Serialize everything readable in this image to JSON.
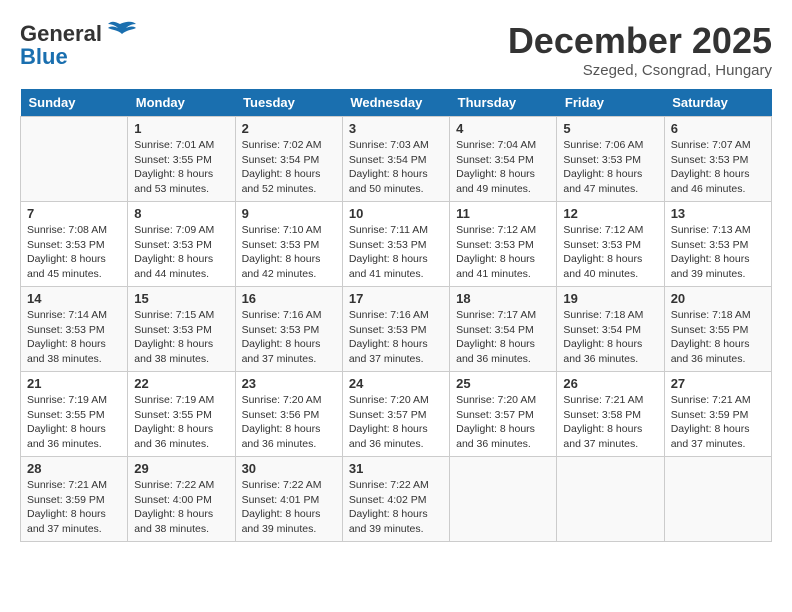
{
  "header": {
    "logo_general": "General",
    "logo_blue": "Blue",
    "title": "December 2025",
    "location": "Szeged, Csongrad, Hungary"
  },
  "days_of_week": [
    "Sunday",
    "Monday",
    "Tuesday",
    "Wednesday",
    "Thursday",
    "Friday",
    "Saturday"
  ],
  "weeks": [
    [
      {
        "day": "",
        "info": ""
      },
      {
        "day": "1",
        "info": "Sunrise: 7:01 AM\nSunset: 3:55 PM\nDaylight: 8 hours\nand 53 minutes."
      },
      {
        "day": "2",
        "info": "Sunrise: 7:02 AM\nSunset: 3:54 PM\nDaylight: 8 hours\nand 52 minutes."
      },
      {
        "day": "3",
        "info": "Sunrise: 7:03 AM\nSunset: 3:54 PM\nDaylight: 8 hours\nand 50 minutes."
      },
      {
        "day": "4",
        "info": "Sunrise: 7:04 AM\nSunset: 3:54 PM\nDaylight: 8 hours\nand 49 minutes."
      },
      {
        "day": "5",
        "info": "Sunrise: 7:06 AM\nSunset: 3:53 PM\nDaylight: 8 hours\nand 47 minutes."
      },
      {
        "day": "6",
        "info": "Sunrise: 7:07 AM\nSunset: 3:53 PM\nDaylight: 8 hours\nand 46 minutes."
      }
    ],
    [
      {
        "day": "7",
        "info": "Sunrise: 7:08 AM\nSunset: 3:53 PM\nDaylight: 8 hours\nand 45 minutes."
      },
      {
        "day": "8",
        "info": "Sunrise: 7:09 AM\nSunset: 3:53 PM\nDaylight: 8 hours\nand 44 minutes."
      },
      {
        "day": "9",
        "info": "Sunrise: 7:10 AM\nSunset: 3:53 PM\nDaylight: 8 hours\nand 42 minutes."
      },
      {
        "day": "10",
        "info": "Sunrise: 7:11 AM\nSunset: 3:53 PM\nDaylight: 8 hours\nand 41 minutes."
      },
      {
        "day": "11",
        "info": "Sunrise: 7:12 AM\nSunset: 3:53 PM\nDaylight: 8 hours\nand 41 minutes."
      },
      {
        "day": "12",
        "info": "Sunrise: 7:12 AM\nSunset: 3:53 PM\nDaylight: 8 hours\nand 40 minutes."
      },
      {
        "day": "13",
        "info": "Sunrise: 7:13 AM\nSunset: 3:53 PM\nDaylight: 8 hours\nand 39 minutes."
      }
    ],
    [
      {
        "day": "14",
        "info": "Sunrise: 7:14 AM\nSunset: 3:53 PM\nDaylight: 8 hours\nand 38 minutes."
      },
      {
        "day": "15",
        "info": "Sunrise: 7:15 AM\nSunset: 3:53 PM\nDaylight: 8 hours\nand 38 minutes."
      },
      {
        "day": "16",
        "info": "Sunrise: 7:16 AM\nSunset: 3:53 PM\nDaylight: 8 hours\nand 37 minutes."
      },
      {
        "day": "17",
        "info": "Sunrise: 7:16 AM\nSunset: 3:53 PM\nDaylight: 8 hours\nand 37 minutes."
      },
      {
        "day": "18",
        "info": "Sunrise: 7:17 AM\nSunset: 3:54 PM\nDaylight: 8 hours\nand 36 minutes."
      },
      {
        "day": "19",
        "info": "Sunrise: 7:18 AM\nSunset: 3:54 PM\nDaylight: 8 hours\nand 36 minutes."
      },
      {
        "day": "20",
        "info": "Sunrise: 7:18 AM\nSunset: 3:55 PM\nDaylight: 8 hours\nand 36 minutes."
      }
    ],
    [
      {
        "day": "21",
        "info": "Sunrise: 7:19 AM\nSunset: 3:55 PM\nDaylight: 8 hours\nand 36 minutes."
      },
      {
        "day": "22",
        "info": "Sunrise: 7:19 AM\nSunset: 3:55 PM\nDaylight: 8 hours\nand 36 minutes."
      },
      {
        "day": "23",
        "info": "Sunrise: 7:20 AM\nSunset: 3:56 PM\nDaylight: 8 hours\nand 36 minutes."
      },
      {
        "day": "24",
        "info": "Sunrise: 7:20 AM\nSunset: 3:57 PM\nDaylight: 8 hours\nand 36 minutes."
      },
      {
        "day": "25",
        "info": "Sunrise: 7:20 AM\nSunset: 3:57 PM\nDaylight: 8 hours\nand 36 minutes."
      },
      {
        "day": "26",
        "info": "Sunrise: 7:21 AM\nSunset: 3:58 PM\nDaylight: 8 hours\nand 37 minutes."
      },
      {
        "day": "27",
        "info": "Sunrise: 7:21 AM\nSunset: 3:59 PM\nDaylight: 8 hours\nand 37 minutes."
      }
    ],
    [
      {
        "day": "28",
        "info": "Sunrise: 7:21 AM\nSunset: 3:59 PM\nDaylight: 8 hours\nand 37 minutes."
      },
      {
        "day": "29",
        "info": "Sunrise: 7:22 AM\nSunset: 4:00 PM\nDaylight: 8 hours\nand 38 minutes."
      },
      {
        "day": "30",
        "info": "Sunrise: 7:22 AM\nSunset: 4:01 PM\nDaylight: 8 hours\nand 39 minutes."
      },
      {
        "day": "31",
        "info": "Sunrise: 7:22 AM\nSunset: 4:02 PM\nDaylight: 8 hours\nand 39 minutes."
      },
      {
        "day": "",
        "info": ""
      },
      {
        "day": "",
        "info": ""
      },
      {
        "day": "",
        "info": ""
      }
    ]
  ]
}
